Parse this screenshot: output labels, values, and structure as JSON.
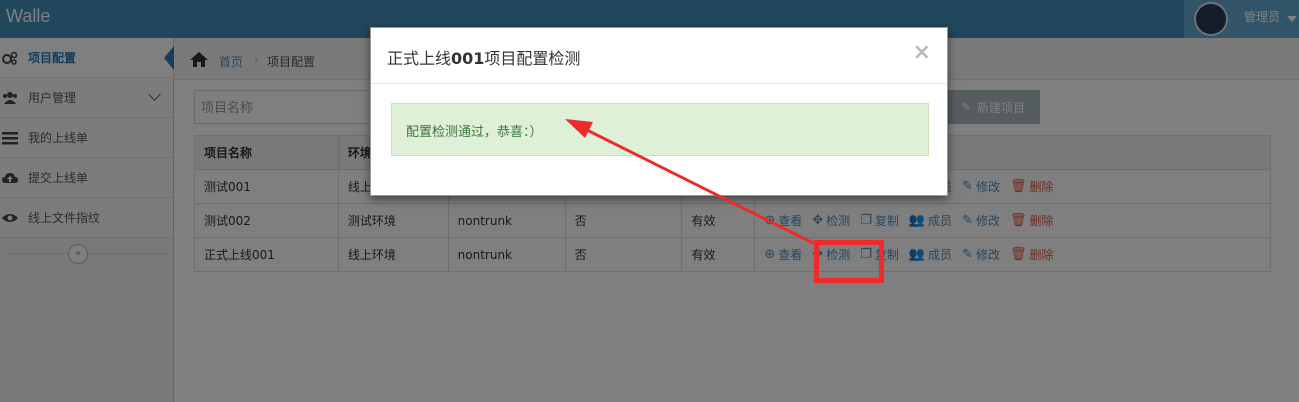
{
  "app": {
    "title": "Walle"
  },
  "user": {
    "name": "管理员"
  },
  "sidebar": {
    "items": [
      {
        "label": "项目配置",
        "icon": "cogs-icon"
      },
      {
        "label": "用户管理",
        "icon": "users-icon"
      },
      {
        "label": "我的上线单",
        "icon": "list-icon"
      },
      {
        "label": "提交上线单",
        "icon": "cloud-upload-icon"
      },
      {
        "label": "线上文件指纹",
        "icon": "eye-icon"
      }
    ],
    "collapse_glyph": "»"
  },
  "breadcrumb": {
    "home": "首页",
    "separator": "›",
    "current": "项目配置"
  },
  "toolbar": {
    "search_placeholder": "项目名称",
    "new_button": "新建项目"
  },
  "table": {
    "headers": [
      "项目名称",
      "环境",
      "",
      "",
      "",
      ""
    ],
    "rows": [
      {
        "name": "测试001",
        "env": "线上",
        "branch": "",
        "audit": "",
        "status": ""
      },
      {
        "name": "测试002",
        "env": "测试环境",
        "branch": "nontrunk",
        "audit": "否",
        "status": "有效"
      },
      {
        "name": "正式上线001",
        "env": "线上环境",
        "branch": "nontrunk",
        "audit": "否",
        "status": "有效"
      }
    ],
    "actions": {
      "view": "查看",
      "check": "检测",
      "copy": "复制",
      "members": "成员",
      "edit": "修改",
      "delete": "删除"
    }
  },
  "modal": {
    "title_prefix": "正式上线",
    "title_number": "001",
    "title_suffix": "项目配置检测",
    "close": "×",
    "message": "配置检测通过，恭喜：）"
  },
  "colors": {
    "topbar": "#438eb9",
    "accent": "#2b7dbc",
    "danger": "#dd5a43",
    "success_bg": "#dff0d8",
    "annotation": "#ee2a2a"
  }
}
